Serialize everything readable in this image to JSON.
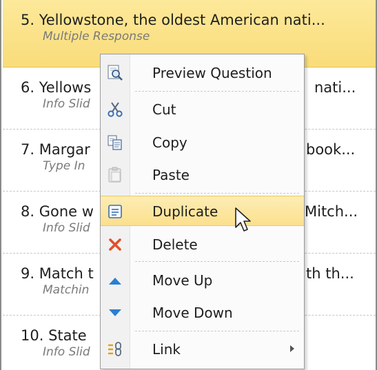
{
  "questions": [
    {
      "title": "5. Yellowstone, the oldest American nati...",
      "type": "Multiple Response"
    },
    {
      "title": "6. Yellows",
      "title_tail": "nati...",
      "type": "Info Slid"
    },
    {
      "title": "7. Margar",
      "title_tail": "book...",
      "type": "Type In"
    },
    {
      "title": "8. Gone w",
      "title_tail": "Mitch...",
      "type": "Info Slid"
    },
    {
      "title": "9. Match t",
      "title_tail": "th th...",
      "type": "Matchin"
    },
    {
      "title": "10. State",
      "type": "Info Slid"
    }
  ],
  "context_menu": {
    "items": [
      {
        "label": "Preview Question",
        "icon": "preview-icon"
      },
      {
        "label": "Cut",
        "icon": "scissors-icon"
      },
      {
        "label": "Copy",
        "icon": "copy-icon"
      },
      {
        "label": "Paste",
        "icon": "paste-icon"
      },
      {
        "label": "Duplicate",
        "icon": "duplicate-icon"
      },
      {
        "label": "Delete",
        "icon": "delete-icon"
      },
      {
        "label": "Move Up",
        "icon": "arrow-up-icon"
      },
      {
        "label": "Move Down",
        "icon": "arrow-down-icon"
      },
      {
        "label": "Link",
        "icon": "link-icon"
      }
    ]
  },
  "colors": {
    "selected_row": "#fbe287",
    "menu_hover": "#fbe08d",
    "delete_red": "#e0502a",
    "arrow_blue": "#2a7fcf"
  }
}
